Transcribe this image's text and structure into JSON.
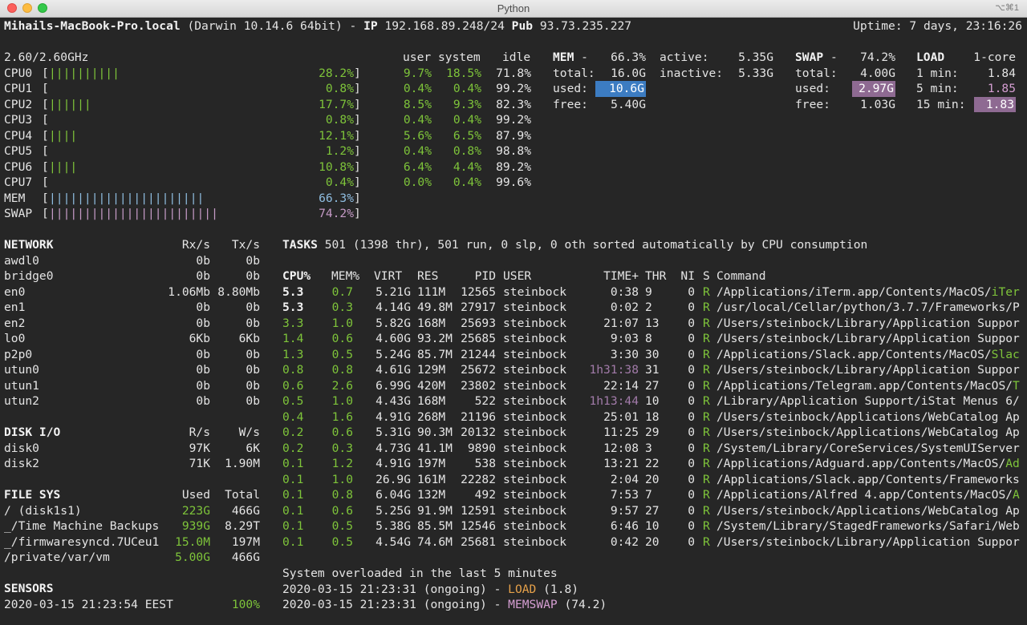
{
  "window": {
    "title": "Python",
    "shortcut": "⌥⌘1"
  },
  "header": {
    "host": "Mihails-MacBook-Pro.local",
    "os": "(Darwin 10.14.6 64bit) -",
    "ip_label": "IP",
    "ip": "192.168.89.248/24",
    "pub_label": "Pub",
    "pub": "93.73.235.227",
    "uptime": "Uptime: 7 days, 23:16:26"
  },
  "cpu": {
    "freq": "2.60/2.60GHz",
    "headers": {
      "user": "user",
      "system": "system",
      "idle": "idle"
    },
    "cores": [
      {
        "name": "CPU0",
        "bar": "||||||||||",
        "pct": "28.2%",
        "user": "9.7%",
        "system": "18.5%",
        "idle": "71.8%"
      },
      {
        "name": "CPU1",
        "bar": "",
        "pct": "0.8%",
        "user": "0.4%",
        "system": "0.4%",
        "idle": "99.2%"
      },
      {
        "name": "CPU2",
        "bar": "||||||",
        "pct": "17.7%",
        "user": "8.5%",
        "system": "9.3%",
        "idle": "82.3%"
      },
      {
        "name": "CPU3",
        "bar": "",
        "pct": "0.8%",
        "user": "0.4%",
        "system": "0.4%",
        "idle": "99.2%"
      },
      {
        "name": "CPU4",
        "bar": "||||",
        "pct": "12.1%",
        "user": "5.6%",
        "system": "6.5%",
        "idle": "87.9%"
      },
      {
        "name": "CPU5",
        "bar": "",
        "pct": "1.2%",
        "user": "0.4%",
        "system": "0.8%",
        "idle": "98.8%"
      },
      {
        "name": "CPU6",
        "bar": "||||",
        "pct": "10.8%",
        "user": "6.4%",
        "system": "4.4%",
        "idle": "89.2%"
      },
      {
        "name": "CPU7",
        "bar": "",
        "pct": "0.4%",
        "user": "0.0%",
        "system": "0.4%",
        "idle": "99.6%"
      }
    ],
    "mem_bar": {
      "name": "MEM",
      "bar": "||||||||||||||||||||||",
      "pct": "66.3%"
    },
    "swap_bar": {
      "name": "SWAP",
      "bar": "||||||||||||||||||||||||",
      "pct": "74.2%"
    }
  },
  "mem": {
    "title": "MEM",
    "pct": "66.3%",
    "total_label": "total:",
    "total": "16.0G",
    "used_label": "used:",
    "used": "10.6G",
    "free_label": "free:",
    "free": "5.40G",
    "active_label": "active:",
    "active": "5.35G",
    "inactive_label": "inactive:",
    "inactive": "5.33G"
  },
  "swap": {
    "title": "SWAP",
    "pct": "74.2%",
    "total_label": "total:",
    "total": "4.00G",
    "used_label": "used:",
    "used": "2.97G",
    "free_label": "free:",
    "free": "1.03G"
  },
  "load": {
    "title": "LOAD",
    "cores": "1-core",
    "m1_label": "1 min:",
    "m1": "1.84",
    "m5_label": "5 min:",
    "m5": "1.85",
    "m15_label": "15 min:",
    "m15": "1.83"
  },
  "network": {
    "title": "NETWORK",
    "rx": "Rx/s",
    "tx": "Tx/s",
    "rows": [
      {
        "name": "awdl0",
        "rx": "0b",
        "tx": "0b"
      },
      {
        "name": "bridge0",
        "rx": "0b",
        "tx": "0b"
      },
      {
        "name": "en0",
        "rx": "1.06Mb",
        "tx": "8.80Mb"
      },
      {
        "name": "en1",
        "rx": "0b",
        "tx": "0b"
      },
      {
        "name": "en2",
        "rx": "0b",
        "tx": "0b"
      },
      {
        "name": "lo0",
        "rx": "6Kb",
        "tx": "6Kb"
      },
      {
        "name": "p2p0",
        "rx": "0b",
        "tx": "0b"
      },
      {
        "name": "utun0",
        "rx": "0b",
        "tx": "0b"
      },
      {
        "name": "utun1",
        "rx": "0b",
        "tx": "0b"
      },
      {
        "name": "utun2",
        "rx": "0b",
        "tx": "0b"
      }
    ]
  },
  "disk": {
    "title": "DISK I/O",
    "r": "R/s",
    "w": "W/s",
    "rows": [
      {
        "name": "disk0",
        "r": "97K",
        "w": "6K"
      },
      {
        "name": "disk2",
        "r": "71K",
        "w": "1.90M"
      }
    ]
  },
  "fs": {
    "title": "FILE SYS",
    "used": "Used",
    "total": "Total",
    "rows": [
      {
        "name": "/ (disk1s1)",
        "used": "223G",
        "total": "466G"
      },
      {
        "name": "_/Time Machine Backups",
        "used": "939G",
        "total": "8.29T"
      },
      {
        "name": "_/firmwaresyncd.7UCeu1",
        "used": "15.0M",
        "total": "197M"
      },
      {
        "name": "/private/var/vm",
        "used": "5.00G",
        "total": "466G"
      }
    ]
  },
  "sensors": {
    "title": "SENSORS",
    "time": "2020-03-15 21:23:54 EEST",
    "value": "100%"
  },
  "tasks": {
    "title": "TASKS",
    "summary": "501 (1398 thr), 501 run, 0 slp, 0 oth sorted automatically by CPU consumption",
    "columns": {
      "cpu": "CPU%",
      "mem": "MEM%",
      "virt": "VIRT",
      "res": "RES",
      "pid": "PID",
      "user": "USER",
      "time": "TIME+",
      "thr": "THR",
      "ni": "NI",
      "s": "S",
      "cmd": "Command"
    },
    "rows": [
      {
        "cpu": "5.3",
        "mem": "0.7",
        "virt": "5.21G",
        "res": "111M",
        "pid": "12565",
        "user": "steinbock",
        "time": "0:38",
        "thr": "9",
        "ni": "0",
        "s": "R",
        "cmd": "/Applications/iTerm.app/Contents/MacOS/",
        "cmd_hl": "iTer"
      },
      {
        "cpu": "5.3",
        "mem": "0.3",
        "virt": "4.14G",
        "res": "49.8M",
        "pid": "27917",
        "user": "steinbock",
        "time": "0:02",
        "thr": "2",
        "ni": "0",
        "s": "R",
        "cmd": "/usr/local/Cellar/python/3.7.7/Frameworks/P",
        "cmd_hl": ""
      },
      {
        "cpu": "3.3",
        "mem": "1.0",
        "virt": "5.82G",
        "res": "168M",
        "pid": "25693",
        "user": "steinbock",
        "time": "21:07",
        "thr": "13",
        "ni": "0",
        "s": "R",
        "cmd": "/Users/steinbock/Library/Application Suppor",
        "cmd_hl": ""
      },
      {
        "cpu": "1.4",
        "mem": "0.6",
        "virt": "4.60G",
        "res": "93.2M",
        "pid": "25685",
        "user": "steinbock",
        "time": "9:03",
        "thr": "8",
        "ni": "0",
        "s": "R",
        "cmd": "/Users/steinbock/Library/Application Suppor",
        "cmd_hl": ""
      },
      {
        "cpu": "1.3",
        "mem": "0.5",
        "virt": "5.24G",
        "res": "85.7M",
        "pid": "21244",
        "user": "steinbock",
        "time": "3:30",
        "thr": "30",
        "ni": "0",
        "s": "R",
        "cmd": "/Applications/Slack.app/Contents/MacOS/",
        "cmd_hl": "Slac"
      },
      {
        "cpu": "0.8",
        "mem": "0.8",
        "virt": "4.61G",
        "res": "129M",
        "pid": "25672",
        "user": "steinbock",
        "time": "1h31:38",
        "thr": "31",
        "ni": "0",
        "s": "R",
        "cmd": "/Users/steinbock/Library/Application Suppor",
        "cmd_hl": ""
      },
      {
        "cpu": "0.6",
        "mem": "2.6",
        "virt": "6.99G",
        "res": "420M",
        "pid": "23802",
        "user": "steinbock",
        "time": "22:14",
        "thr": "27",
        "ni": "0",
        "s": "R",
        "cmd": "/Applications/Telegram.app/Contents/MacOS/",
        "cmd_hl": "T"
      },
      {
        "cpu": "0.5",
        "mem": "1.0",
        "virt": "4.43G",
        "res": "168M",
        "pid": "522",
        "user": "steinbock",
        "time": "1h13:44",
        "thr": "10",
        "ni": "0",
        "s": "R",
        "cmd": "/Library/Application Support/iStat Menus 6/",
        "cmd_hl": ""
      },
      {
        "cpu": "0.4",
        "mem": "1.6",
        "virt": "4.91G",
        "res": "268M",
        "pid": "21196",
        "user": "steinbock",
        "time": "25:01",
        "thr": "18",
        "ni": "0",
        "s": "R",
        "cmd": "/Users/steinbock/Applications/WebCatalog Ap",
        "cmd_hl": ""
      },
      {
        "cpu": "0.2",
        "mem": "0.6",
        "virt": "5.31G",
        "res": "90.3M",
        "pid": "20132",
        "user": "steinbock",
        "time": "11:25",
        "thr": "29",
        "ni": "0",
        "s": "R",
        "cmd": "/Users/steinbock/Applications/WebCatalog Ap",
        "cmd_hl": ""
      },
      {
        "cpu": "0.2",
        "mem": "0.3",
        "virt": "4.73G",
        "res": "41.1M",
        "pid": "9890",
        "user": "steinbock",
        "time": "12:08",
        "thr": "3",
        "ni": "0",
        "s": "R",
        "cmd": "/System/Library/CoreServices/SystemUIServer",
        "cmd_hl": ""
      },
      {
        "cpu": "0.1",
        "mem": "1.2",
        "virt": "4.91G",
        "res": "197M",
        "pid": "538",
        "user": "steinbock",
        "time": "13:21",
        "thr": "22",
        "ni": "0",
        "s": "R",
        "cmd": "/Applications/Adguard.app/Contents/MacOS/",
        "cmd_hl": "Ad"
      },
      {
        "cpu": "0.1",
        "mem": "1.0",
        "virt": "26.9G",
        "res": "161M",
        "pid": "22282",
        "user": "steinbock",
        "time": "2:04",
        "thr": "20",
        "ni": "0",
        "s": "R",
        "cmd": "/Applications/Slack.app/Contents/Frameworks",
        "cmd_hl": ""
      },
      {
        "cpu": "0.1",
        "mem": "0.8",
        "virt": "6.04G",
        "res": "132M",
        "pid": "492",
        "user": "steinbock",
        "time": "7:53",
        "thr": "7",
        "ni": "0",
        "s": "R",
        "cmd": "/Applications/Alfred 4.app/Contents/MacOS/",
        "cmd_hl": "A"
      },
      {
        "cpu": "0.1",
        "mem": "0.6",
        "virt": "5.25G",
        "res": "91.9M",
        "pid": "12591",
        "user": "steinbock",
        "time": "9:57",
        "thr": "27",
        "ni": "0",
        "s": "R",
        "cmd": "/Users/steinbock/Applications/WebCatalog Ap",
        "cmd_hl": ""
      },
      {
        "cpu": "0.1",
        "mem": "0.5",
        "virt": "5.38G",
        "res": "85.5M",
        "pid": "12546",
        "user": "steinbock",
        "time": "6:46",
        "thr": "10",
        "ni": "0",
        "s": "R",
        "cmd": "/System/Library/StagedFrameworks/Safari/Web",
        "cmd_hl": ""
      },
      {
        "cpu": "0.1",
        "mem": "0.5",
        "virt": "4.54G",
        "res": "74.6M",
        "pid": "25681",
        "user": "steinbock",
        "time": "0:42",
        "thr": "20",
        "ni": "0",
        "s": "R",
        "cmd": "/Users/steinbock/Library/Application Suppor",
        "cmd_hl": ""
      }
    ]
  },
  "alerts": {
    "title": "System overloaded in the last 5 minutes",
    "rows": [
      {
        "time": "2020-03-15 21:23:31 (ongoing) -",
        "name": "LOAD",
        "value": "(1.8)"
      },
      {
        "time": "2020-03-15 21:23:31 (ongoing) -",
        "name": "MEMSWAP",
        "value": "(74.2)"
      }
    ]
  }
}
